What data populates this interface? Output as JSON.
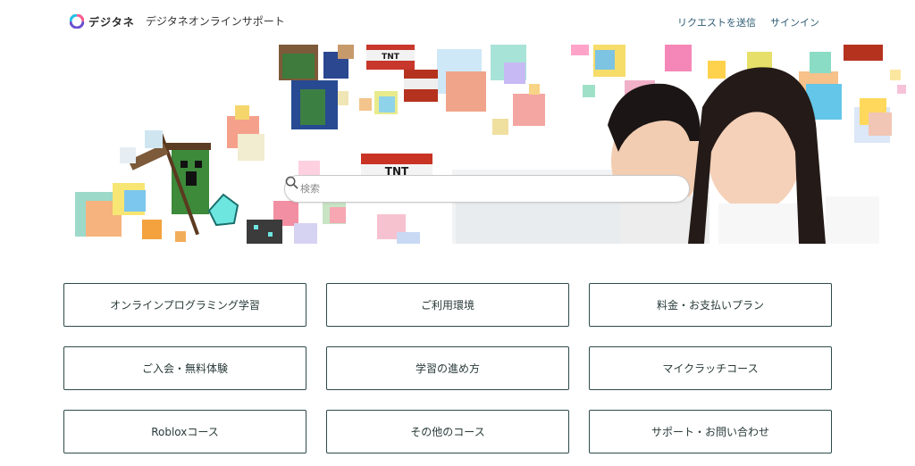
{
  "header": {
    "logo_text": "デジタネ",
    "site_title": "デジタネオンラインサポート",
    "nav": [
      {
        "label": "リクエストを送信"
      },
      {
        "label": "サインイン"
      }
    ]
  },
  "search": {
    "placeholder": "検索",
    "icon": "search-icon"
  },
  "hero_text": {
    "tnt": "TNT"
  },
  "categories": [
    {
      "label": "オンラインプログラミング学習"
    },
    {
      "label": "ご利用環境"
    },
    {
      "label": "料金・お支払いプラン"
    },
    {
      "label": "ご入会・無料体験"
    },
    {
      "label": "学習の進め方"
    },
    {
      "label": "マイクラッチコース"
    },
    {
      "label": "Robloxコース"
    },
    {
      "label": "その他のコース"
    },
    {
      "label": "サポート・お問い合わせ"
    }
  ],
  "colors": {
    "accent": "#2d5b73",
    "border": "#2e4b4b",
    "text": "#2a3b3a"
  }
}
